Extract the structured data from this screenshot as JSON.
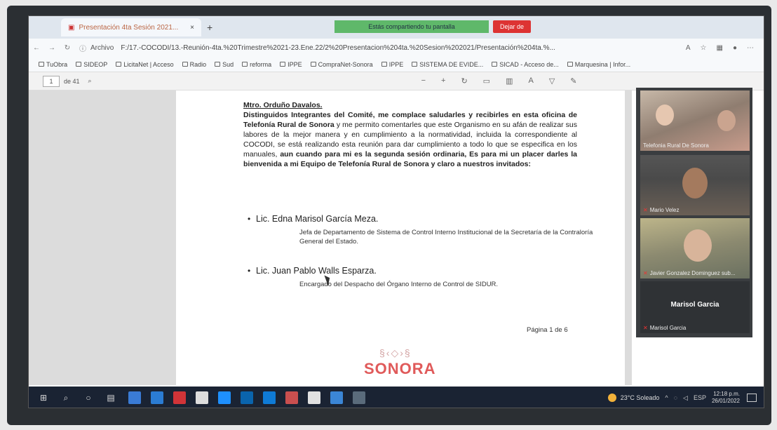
{
  "browser": {
    "tab_title": "Presentación 4ta Sesión 2021...",
    "tab_close": "×",
    "new_tab": "+",
    "meeting_bar": "Estás compartiendo tu pantalla",
    "stop_share": "Dejar de",
    "address_prefix": "Archivo",
    "url": "F:/17.-COCODI/13.-Reunión-4ta.%20Trimestre%2021-23.Ene.22/2%20Presentacion%204ta.%20Sesion%202021/Presentación%204ta.%..."
  },
  "bookmarks": [
    "TuObra",
    "SIDEOP",
    "LicitaNet | Acceso",
    "Radio",
    "Sud",
    "reforma",
    "IPPE",
    "CompraNet-Sonora",
    "IPPE",
    "SISTEMA DE EVIDE...",
    "SICAD - Acceso de...",
    "Marquesina | Infor..."
  ],
  "pdf": {
    "page_current": "1",
    "page_total": "de 41"
  },
  "document": {
    "header": "Mtro. Orduño Davalos.",
    "p_bold_1": "Distinguidos Integrantes del Comité, me complace saludarles y recibirles en esta oficina de Telefonía Rural de Sonora",
    "p_normal": " y me permito comentarles que este Organismo en su afán de realizar sus labores de la mejor manera y en cumplimiento a la normatividad, incluida la correspondiente al COCODI, se está realizando esta reunión para dar cumplimiento a todo lo que se especifica en los manuales, ",
    "p_bold_2": "aun cuando para mi es la segunda sesión ordinaria, Es para mi un placer darles la bienvenida a mi Equipo de Telefonía Rural de Sonora y claro a nuestros invitados:",
    "invitee_1_name": "Lic. Edna Marisol García Meza.",
    "invitee_1_role": "Jefa de Departamento de Sistema de Control Interno Institucional de la Secretaría de la Contraloría General del Estado.",
    "invitee_2_name": "Lic. Juan Pablo Walls Esparza.",
    "invitee_2_role": "Encargado del Despacho del Órgano Interno de Control de SIDUR.",
    "page_label": "Página 1 de 6",
    "logo_text": "SONORA"
  },
  "participants": [
    {
      "label": "Telefonia Rural De Sonora"
    },
    {
      "label": "Mario Velez"
    },
    {
      "label": "Javier Gonzalez Dominguez sub..."
    },
    {
      "name": "Marisol Garcia",
      "label": "Marisol Garcia"
    }
  ],
  "taskbar": {
    "weather": "23°C Soleado",
    "lang": "ESP",
    "time": "12:18 p.m.",
    "date": "26/01/2022"
  },
  "colors": {
    "taskbar": "#1a2333",
    "meeting_green": "#5fb86a",
    "stop_red": "#dd3333",
    "logo_red": "#e05a5a"
  }
}
